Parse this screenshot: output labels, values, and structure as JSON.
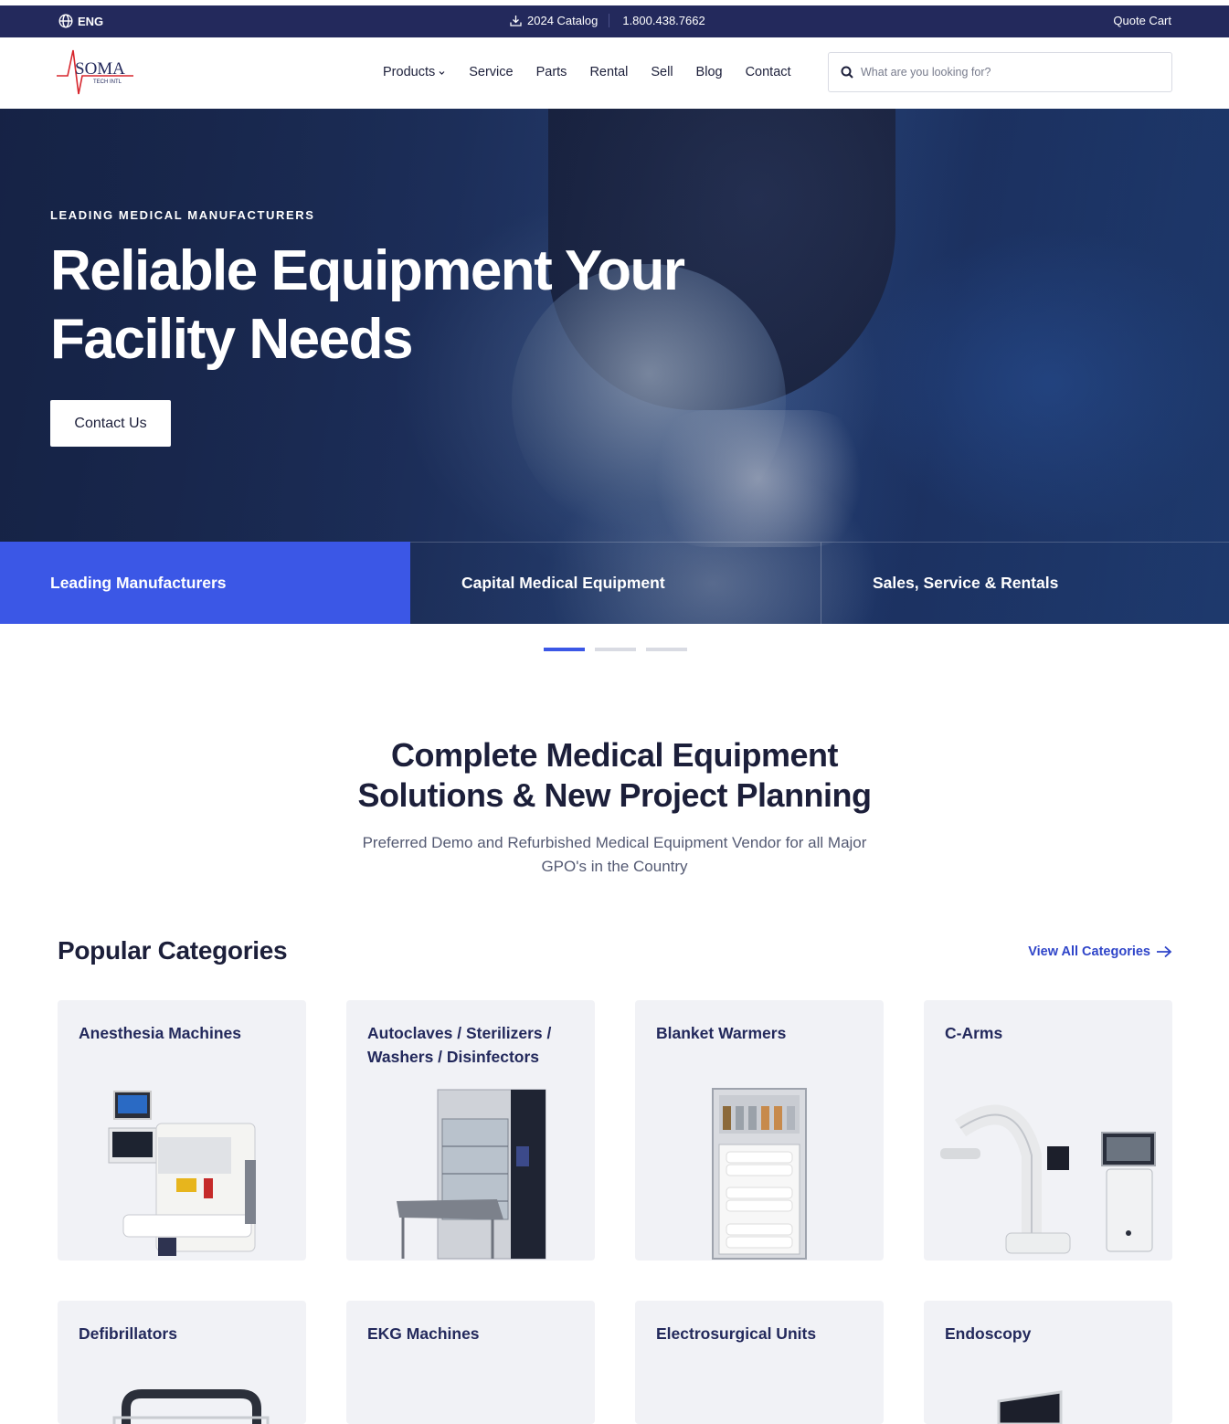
{
  "topbar": {
    "language": "ENG",
    "catalog": "2024 Catalog",
    "phone": "1.800.438.7662",
    "quote_cart": "Quote Cart"
  },
  "header": {
    "logo_text": "SOMA",
    "logo_subtext": "TECH INTL",
    "nav": [
      "Products",
      "Service",
      "Parts",
      "Rental",
      "Sell",
      "Blog",
      "Contact"
    ],
    "search_placeholder": "What are you looking for?"
  },
  "hero": {
    "eyebrow": "LEADING MEDICAL MANUFACTURERS",
    "title": "Reliable Equipment Your Facility Needs",
    "cta": "Contact Us",
    "tabs": [
      "Leading Manufacturers",
      "Capital Medical Equipment",
      "Sales, Service & Rentals"
    ],
    "active_slide": 1,
    "slide_count": 3
  },
  "intro": {
    "title_line1": "Complete Medical Equipment",
    "title_line2": "Solutions & New Project Planning",
    "subtitle": "Preferred Demo and Refurbished Medical Equipment Vendor for all Major GPO's in the Country"
  },
  "categories": {
    "heading": "Popular Categories",
    "view_all": "View All Categories",
    "items": [
      "Anesthesia Machines",
      "Autoclaves / Sterilizers / Washers / Disinfectors",
      "Blanket Warmers",
      "C-Arms",
      "Defibrillators",
      "EKG Machines",
      "Electrosurgical Units",
      "Endoscopy"
    ]
  },
  "colors": {
    "navy": "#23295c",
    "accent_blue": "#3b57e6",
    "link_blue": "#2f45c9",
    "card_bg": "#f1f2f6",
    "logo_red": "#d7262d"
  }
}
